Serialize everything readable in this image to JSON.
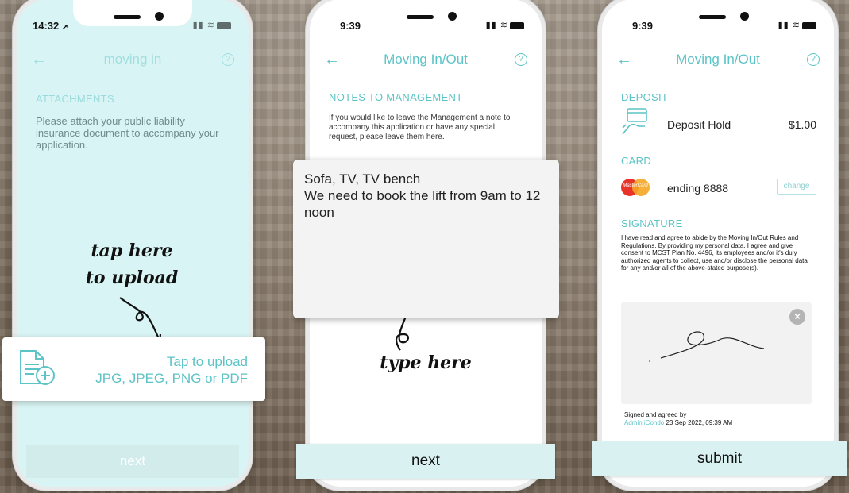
{
  "phone1": {
    "status_time": "14:32",
    "nav_title": "moving in",
    "section": "ATTACHMENTS",
    "text": "Please attach your public liability insurance document to accompany your application.",
    "hint_line1": "tap here",
    "hint_line2": "to upload",
    "upload_title": "Tap to upload",
    "upload_types": "JPG, JPEG, PNG or PDF",
    "next_label": "next"
  },
  "phone2": {
    "status_time": "9:39",
    "nav_title": "Moving In/Out",
    "section": "NOTES TO MANAGEMENT",
    "text": "If you would like to leave the Management a note to accompany this application or have any special request, please leave them here.",
    "note_value": "Sofa, TV, TV bench\nWe need to book the lift from 9am to 12 noon",
    "hint": "type here",
    "next_label": "next"
  },
  "phone3": {
    "status_time": "9:39",
    "nav_title": "Moving In/Out",
    "deposit_head": "DEPOSIT",
    "deposit_label": "Deposit Hold",
    "deposit_amount": "$1.00",
    "card_head": "CARD",
    "card_brand": "MasterCard",
    "card_label": "ending 8888",
    "change_label": "change",
    "signature_head": "SIGNATURE",
    "signature_text": "I have read and agree to abide by the Moving In/Out Rules and Regulations. By providing my personal data, I agree and give consent to MCST Plan No. 4496, its employees and/or it's duly authorized agents to collect, use and/or disclose the personal data for any and/or all of the above-stated purpose(s).",
    "signed_label": "Signed and agreed by",
    "signer": "Admin iCondo",
    "signed_date": "23 Sep 2022, 09:39 AM",
    "submit_label": "submit"
  },
  "colors": {
    "accent": "#5cc3c6",
    "button_bg": "#d9f1f1",
    "screen1_bg": "#d9f4f4"
  },
  "icons": [
    "arrow-left-icon",
    "question-circle-icon",
    "document-plus-icon",
    "credit-card-hand-icon",
    "mastercard-logo",
    "close-circle-icon",
    "wifi-icon",
    "signal-icon",
    "battery-icon",
    "location-arrow-icon"
  ]
}
